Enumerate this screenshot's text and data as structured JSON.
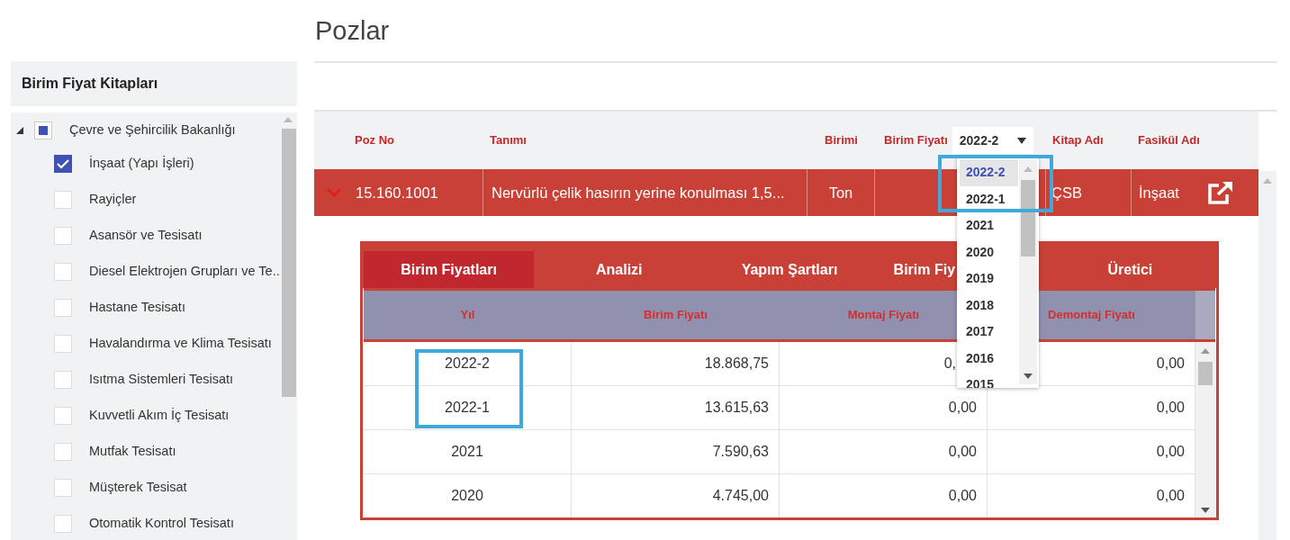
{
  "page_title": "Pozlar",
  "sidebar": {
    "title": "Birim Fiyat Kitapları",
    "tree": [
      {
        "label": "Çevre ve Şehircilik Bakanlığı",
        "expanded": true,
        "indeterminate": true,
        "children": [
          {
            "label": "İnşaat (Yapı İşleri)",
            "checked": true
          },
          {
            "label": "Rayiçler",
            "checked": false
          },
          {
            "label": "Asansör ve Tesisatı",
            "checked": false
          },
          {
            "label": "Diesel Elektrojen Grupları ve Te..",
            "checked": false
          },
          {
            "label": "Hastane Tesisatı",
            "checked": false
          },
          {
            "label": "Havalandırma ve Klima Tesisatı",
            "checked": false
          },
          {
            "label": "Isıtma Sistemleri Tesisatı",
            "checked": false
          },
          {
            "label": "Kuvvetli Akım İç Tesisatı",
            "checked": false
          },
          {
            "label": "Mutfak Tesisatı",
            "checked": false
          },
          {
            "label": "Müşterek Tesisat",
            "checked": false
          },
          {
            "label": "Otomatik Kontrol Tesisatı",
            "checked": false
          }
        ]
      }
    ]
  },
  "table": {
    "columns": [
      "Poz No",
      "Tanımı",
      "Birimi",
      "Birim Fiyatı",
      "Kitap Adı",
      "Fasikül Adı"
    ],
    "year_select": {
      "value": "2022-2",
      "options": [
        {
          "label": "2022-2",
          "selected": true
        },
        {
          "label": "2022-1",
          "selected": false
        },
        {
          "label": "2021",
          "selected": false
        },
        {
          "label": "2020",
          "selected": false
        },
        {
          "label": "2019",
          "selected": false
        },
        {
          "label": "2018",
          "selected": false
        },
        {
          "label": "2017",
          "selected": false
        },
        {
          "label": "2016",
          "selected": false
        },
        {
          "label": "2015",
          "selected": false
        }
      ]
    },
    "rows": [
      {
        "expanded": true,
        "poz_no": "15.160.1001",
        "tanimi": "Nervürlü çelik hasırın yerine konulması 1,5...",
        "birimi": "Ton",
        "kitap_adi": "ÇSB",
        "fasikul_adi": "İnşaat"
      }
    ]
  },
  "detail": {
    "tabs": [
      {
        "label": "Birim Fiyatları",
        "selected": true,
        "partial": false
      },
      {
        "label": "Analizi",
        "selected": false,
        "partial": false
      },
      {
        "label": "Yapım Şartları",
        "selected": false,
        "partial": false
      },
      {
        "label": "Birim Fiy",
        "selected": false,
        "partial": true
      },
      {
        "label": "Üretici",
        "selected": false,
        "partial": false
      }
    ],
    "columns": [
      "Yıl",
      "Birim Fiyatı",
      "Montaj Fiyatı",
      "Demontaj Fiyatı"
    ],
    "rows": [
      {
        "cells": [
          "2022-2",
          "18.868,75",
          "0,",
          "0,00"
        ],
        "partial": true
      },
      {
        "cells": [
          "2022-1",
          "13.615,63",
          "0,00",
          "0,00"
        ],
        "partial": false
      },
      {
        "cells": [
          "2021",
          "7.590,63",
          "0,00",
          "0,00"
        ],
        "partial": false
      },
      {
        "cells": [
          "2020",
          "4.745,00",
          "0,00",
          "0,00"
        ],
        "partial": false
      }
    ]
  }
}
